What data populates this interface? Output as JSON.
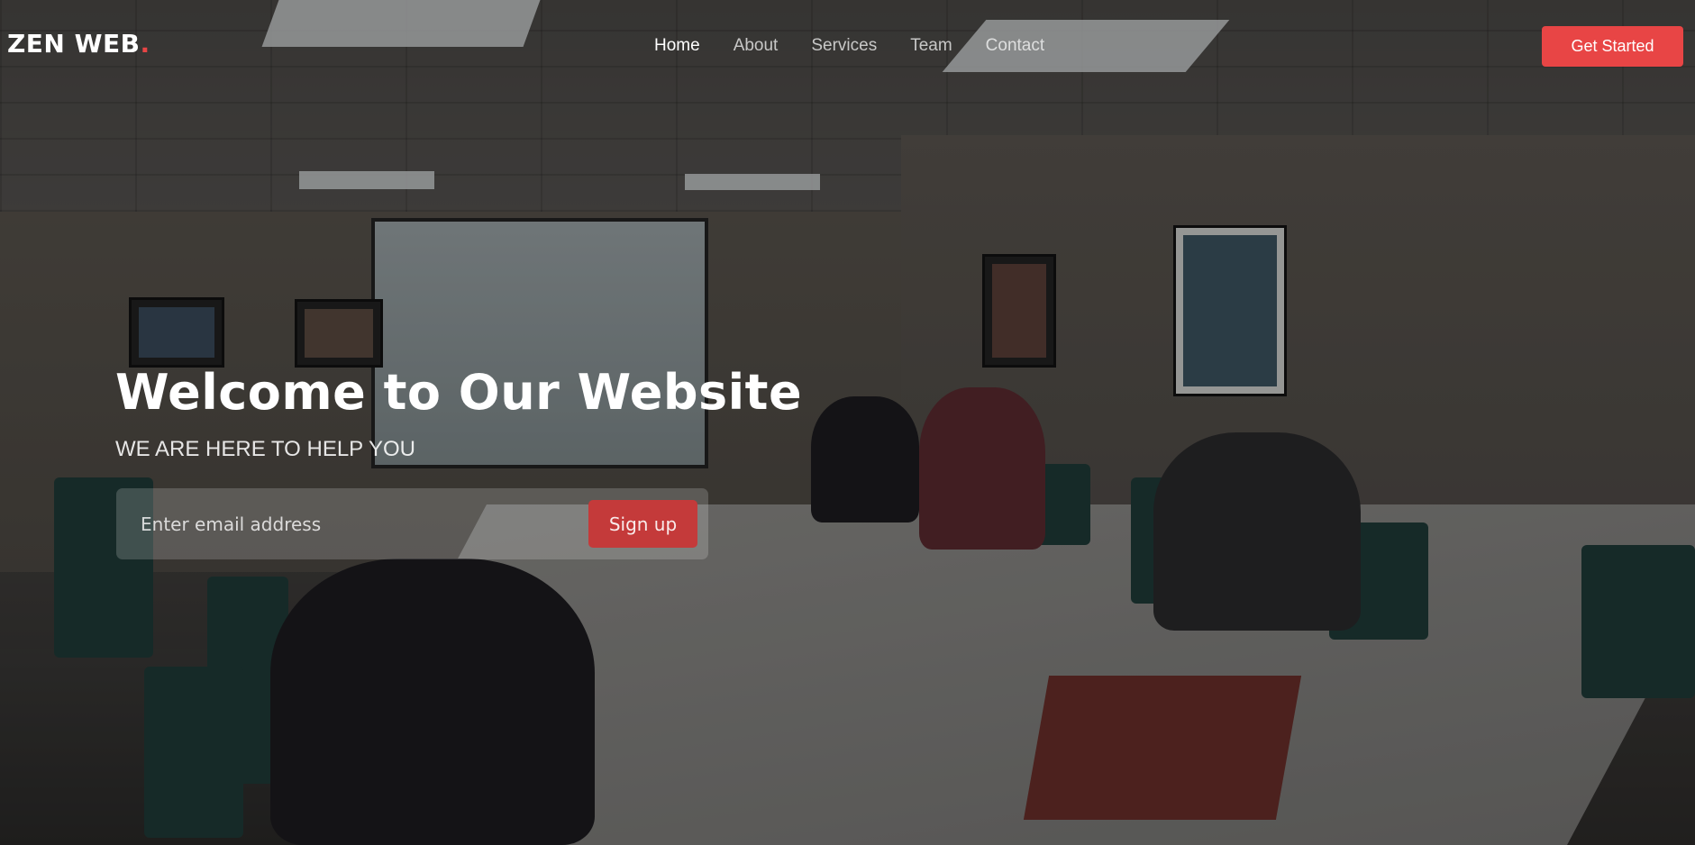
{
  "header": {
    "logo_text": "ZEN WEB",
    "logo_dot": ".",
    "nav": [
      {
        "label": "Home",
        "active": true
      },
      {
        "label": "About",
        "active": false
      },
      {
        "label": "Services",
        "active": false
      },
      {
        "label": "Team",
        "active": false
      },
      {
        "label": "Contact",
        "active": false
      }
    ],
    "cta_label": "Get Started"
  },
  "hero": {
    "title": "Welcome to Our Website",
    "subtitle": "WE ARE HERE TO HELP YOU",
    "email_placeholder": "Enter email address",
    "email_value": "",
    "signup_label": "Sign up"
  },
  "colors": {
    "accent": "#e84545",
    "text": "#ffffff"
  },
  "icons": {
    "background": "conference-room-photo"
  }
}
